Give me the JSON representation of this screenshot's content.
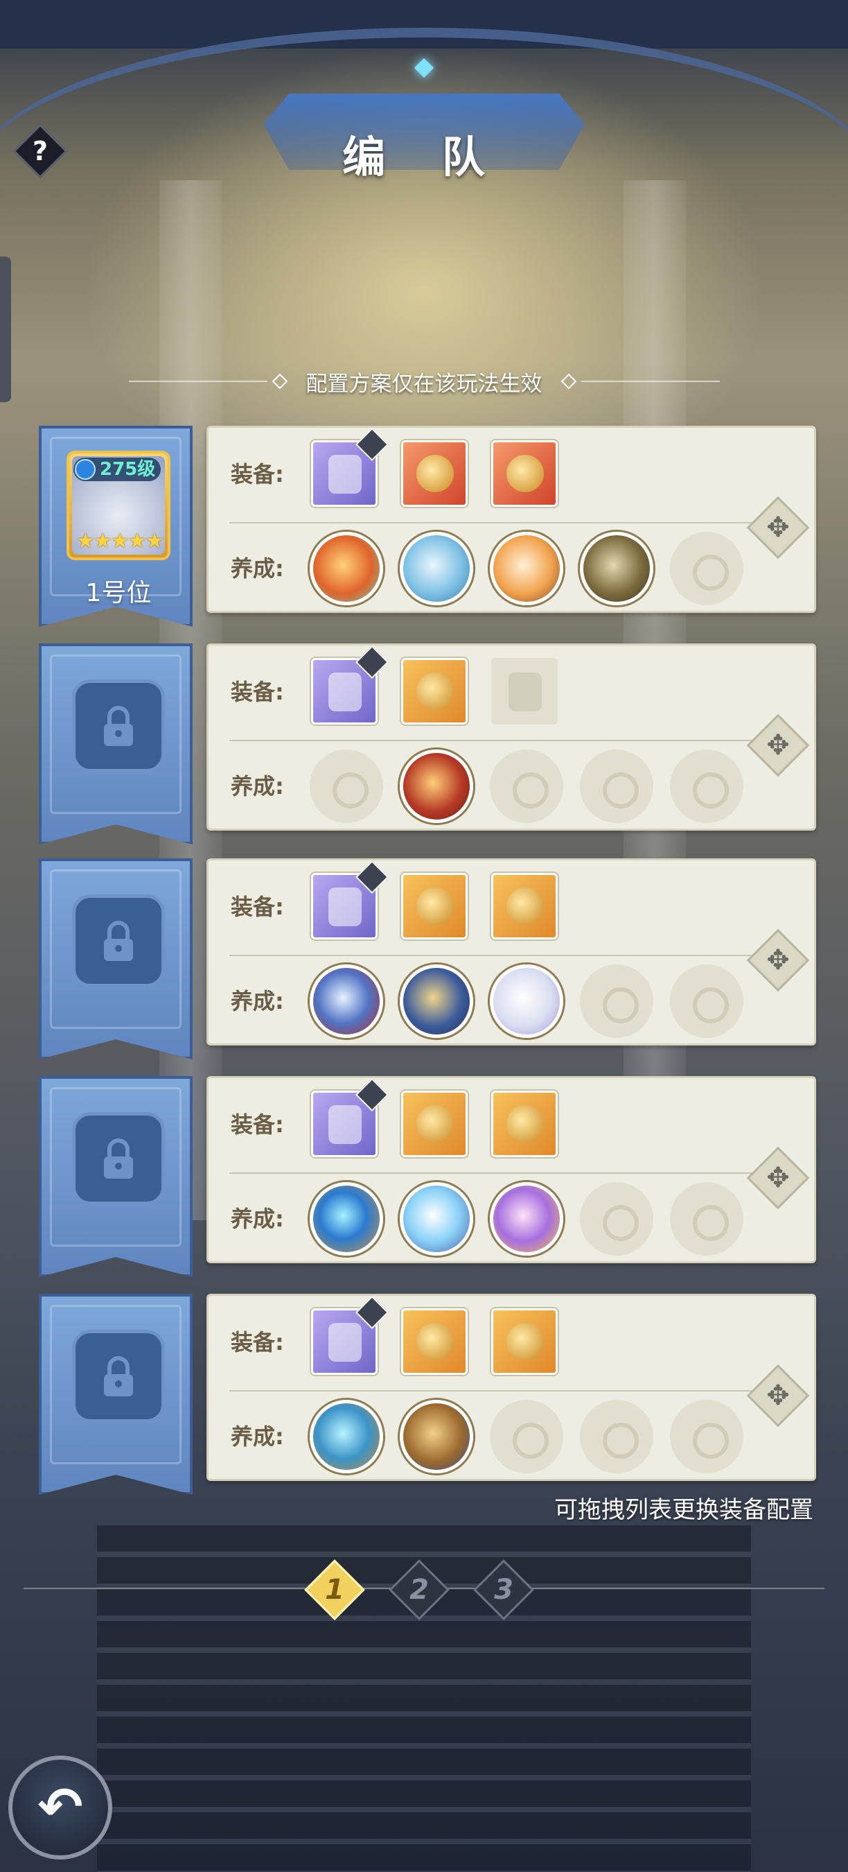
{
  "header": {
    "title": "编 队",
    "help_label": "?"
  },
  "notice": {
    "text": "配置方案仅在该玩法生效"
  },
  "labels": {
    "equip": "装备:",
    "train": "养成:"
  },
  "slots": [
    {
      "label": "1号位",
      "locked": false,
      "hero": {
        "level": "275级",
        "stars": "★★★★★"
      }
    },
    {
      "label": "",
      "locked": true
    },
    {
      "label": "",
      "locked": true
    },
    {
      "label": "",
      "locked": true
    },
    {
      "label": "",
      "locked": true
    }
  ],
  "rows": [
    {
      "equipment": [
        "purple-armor",
        "red-amulet",
        "red-amulet"
      ],
      "training": [
        "fire-dragon",
        "ice-spirit",
        "fox-pet",
        "tree-spirit",
        "empty"
      ]
    },
    {
      "equipment": [
        "purple-armor",
        "gold-amulet",
        "empty"
      ],
      "training": [
        "empty",
        "red-tome",
        "empty",
        "empty",
        "empty"
      ]
    },
    {
      "equipment": [
        "purple-armor",
        "gold-amulet",
        "gold-amulet"
      ],
      "training": [
        "eye-rune",
        "blue-tome",
        "white-cat",
        "empty",
        "empty"
      ]
    },
    {
      "equipment": [
        "purple-armor",
        "gold-amulet",
        "gold-amulet"
      ],
      "training": [
        "trident-rune",
        "star-tome",
        "purple-bird",
        "empty",
        "empty"
      ]
    },
    {
      "equipment": [
        "purple-armor",
        "gold-amulet",
        "gold-amulet"
      ],
      "training": [
        "triangle-rune",
        "brown-tome",
        "empty",
        "empty",
        "empty"
      ]
    }
  ],
  "hint": "可拖拽列表更换装备配置",
  "pager": {
    "pages": [
      "1",
      "2",
      "3"
    ],
    "active": "1"
  },
  "icons": {
    "drag": "move-arrows-icon",
    "back": "back-arrow-icon",
    "lock": "lock-icon",
    "help": "question-icon"
  },
  "colors": {
    "banner": "#6f97cd",
    "panel": "#eeede1",
    "active_page": "#f2d15e",
    "level_text": "#6ff2d0"
  }
}
